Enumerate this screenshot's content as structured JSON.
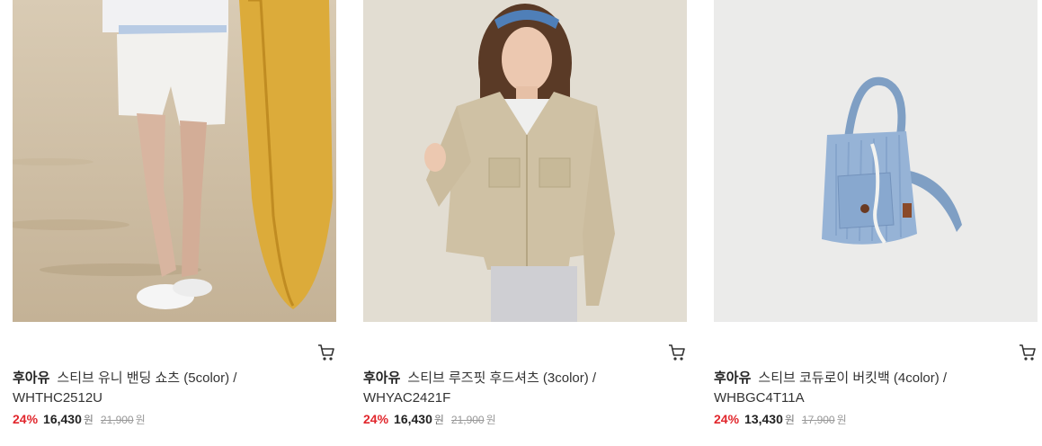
{
  "colors": {
    "discount": "#e1262c",
    "text": "#222222",
    "muted": "#999999"
  },
  "products": [
    {
      "brand": "후아유",
      "name_line1": "스티브 유니 밴딩 쇼츠 (5color) /",
      "name_line2": "WHTHC2512U",
      "discount": "24%",
      "sale_price": "16,430",
      "currency": "원",
      "original_price": "21,900",
      "image": "model-white-shorts-surfboard-beach",
      "cart_icon": "cart-icon"
    },
    {
      "brand": "후아유",
      "name_line1": "스티브 루즈핏 후드셔츠 (3color) /",
      "name_line2": "WHYAC2421F",
      "discount": "24%",
      "sale_price": "16,430",
      "currency": "원",
      "original_price": "21,900",
      "image": "model-beige-hood-shirt",
      "cart_icon": "cart-icon"
    },
    {
      "brand": "후아유",
      "name_line1": "스티브 코듀로이 버킷백 (4color) /",
      "name_line2": "WHBGC4T11A",
      "discount": "24%",
      "sale_price": "13,430",
      "currency": "원",
      "original_price": "17,900",
      "image": "blue-corduroy-bucket-bag",
      "cart_icon": "cart-icon"
    }
  ]
}
